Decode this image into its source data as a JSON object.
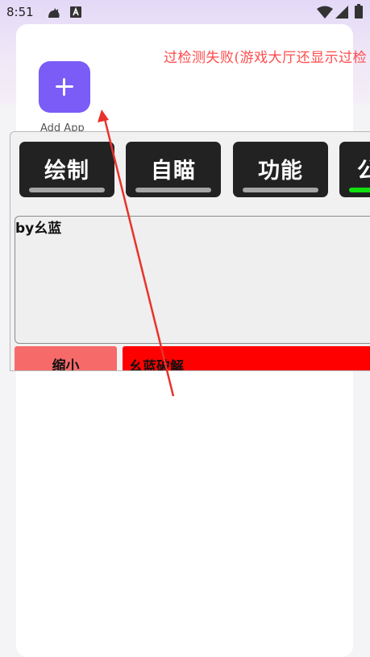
{
  "status_bar": {
    "time": "8:51",
    "icons": [
      "cat-notification-icon",
      "a-box-notification-icon",
      "wifi-icon",
      "signal-icon",
      "battery-icon"
    ]
  },
  "marquee": {
    "text": "过检测失败(游戏大厅还显示过检"
  },
  "add_app": {
    "label": "Add App"
  },
  "tabs": [
    {
      "label": "绘制",
      "active": false
    },
    {
      "label": "自瞄",
      "active": false
    },
    {
      "label": "功能",
      "active": false
    },
    {
      "label": "公",
      "active": true
    }
  ],
  "textbox": {
    "text": "by幺蓝"
  },
  "buttons": {
    "shrink": "缩小",
    "crack": "幺蓝破解"
  },
  "colors": {
    "accent": "#7b5cf6",
    "marquee_text": "#ff4b4b",
    "tab_active_indicator": "#10e010",
    "shrink_button": "#f76a6a",
    "crack_button": "#ff0000",
    "annotation_arrow": "#e8322a"
  }
}
